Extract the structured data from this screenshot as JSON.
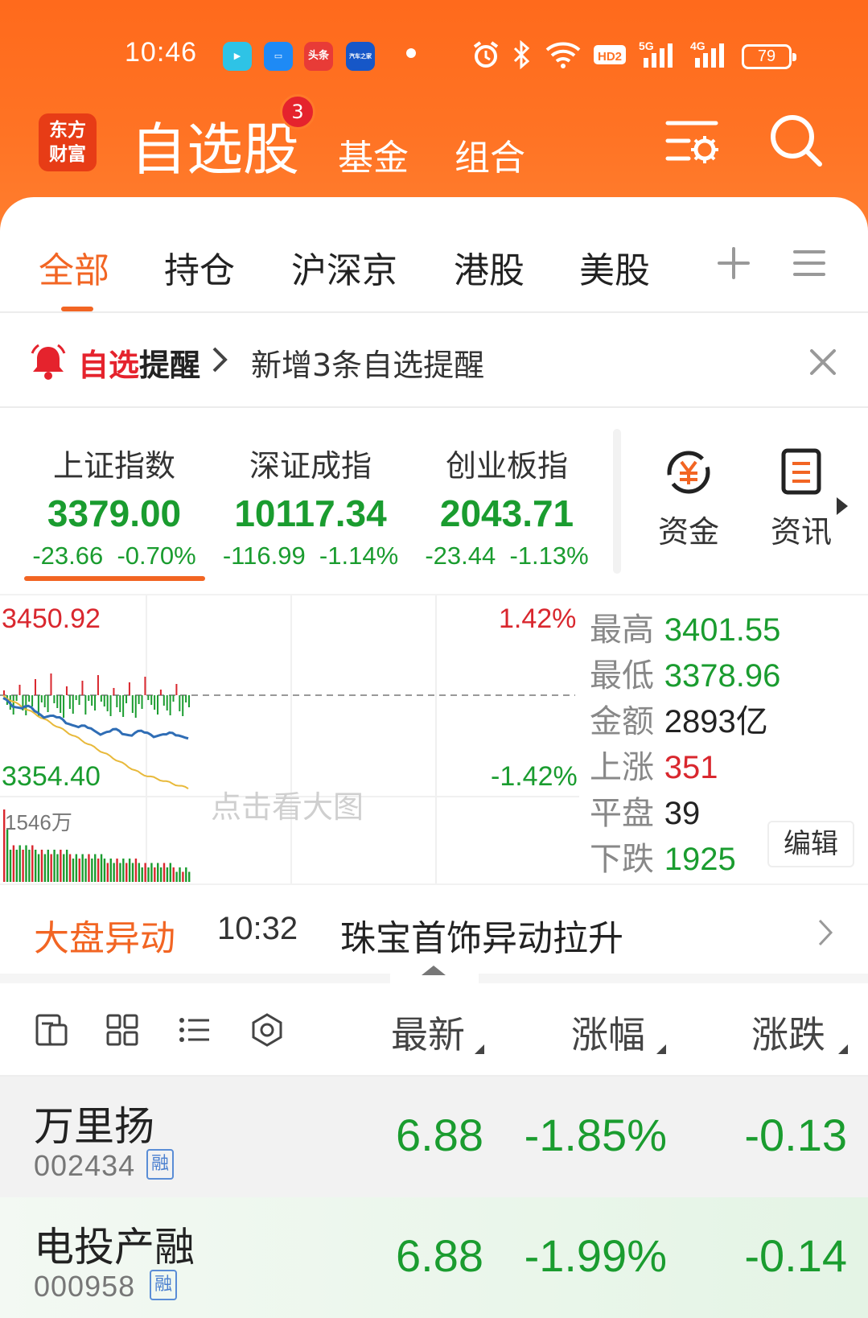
{
  "status_bar": {
    "time": "10:46",
    "battery": "79",
    "apps": [
      "bilibili-app-icon",
      "files-app-icon",
      "toutiao-app-icon",
      "autohome-app-icon"
    ],
    "app_labels": [
      "",
      "",
      "头条",
      "汽车之家"
    ]
  },
  "header": {
    "logo": "东方财富",
    "logo_line1": "东方",
    "logo_line2": "财富",
    "tab_active": "自选股",
    "badge": "3",
    "tab_fund": "基金",
    "tab_combo": "组合"
  },
  "subtabs": [
    "全部",
    "持仓",
    "沪深京",
    "港股",
    "美股"
  ],
  "alert": {
    "title_red": "自选",
    "title_black": "提醒",
    "text": "新增3条自选提醒"
  },
  "indices": [
    {
      "name": "上证指数",
      "value": "3379.00",
      "change": "-23.66",
      "pct": "-0.70%"
    },
    {
      "name": "深证成指",
      "value": "10117.34",
      "change": "-116.99",
      "pct": "-1.14%"
    },
    {
      "name": "创业板指",
      "value": "2043.71",
      "change": "-23.44",
      "pct": "-1.13%"
    }
  ],
  "quick_actions": [
    {
      "label": "资金",
      "icon": "capital-flow-icon"
    },
    {
      "label": "资讯",
      "icon": "news-icon"
    }
  ],
  "chart": {
    "axis_high": "3450.92",
    "axis_low": "3354.40",
    "axis_high_pct": "1.42%",
    "axis_low_pct": "-1.42%",
    "volume_max": "1546万",
    "hint": "点击看大图",
    "colors": {
      "up": "#d9272e",
      "down": "#1a9c2f",
      "price_line": "#2f6db5",
      "avg_line": "#e8b93a"
    }
  },
  "stats": {
    "high_label": "最高",
    "high": "3401.55",
    "low_label": "最低",
    "low": "3378.96",
    "amount_label": "金额",
    "amount": "2893亿",
    "up_label": "上涨",
    "up": "351",
    "flat_label": "平盘",
    "flat": "39",
    "down_label": "下跌",
    "down": "1925",
    "edit": "编辑"
  },
  "movement": {
    "title": "大盘异动",
    "time": "10:32",
    "text": "珠宝首饰异动拉升"
  },
  "list_header": {
    "col_latest": "最新",
    "col_pct": "涨幅",
    "col_change": "涨跌"
  },
  "stocks": [
    {
      "name": "万里扬",
      "code": "002434",
      "tag": "融",
      "price": "6.88",
      "pct": "-1.85%",
      "change": "-0.13"
    },
    {
      "name": "电投产融",
      "code": "000958",
      "tag": "融",
      "price": "6.88",
      "pct": "-1.99%",
      "change": "-0.14"
    }
  ]
}
